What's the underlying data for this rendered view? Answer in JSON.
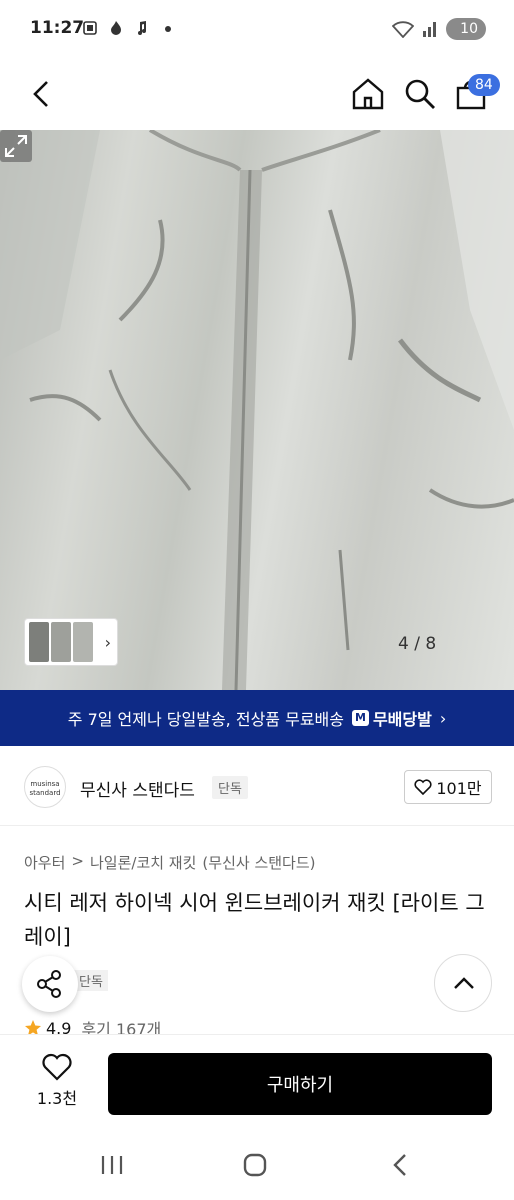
{
  "status": {
    "time": "11:27",
    "battery": "10"
  },
  "nav": {
    "cart_count": "84"
  },
  "gallery": {
    "counter": "4 / 8"
  },
  "banner": {
    "text": "주 7일 언제나 당일발송, 전상품 무료배송",
    "brand_mark": "M",
    "brand_label": "무배당발",
    "arrow": "›"
  },
  "brand": {
    "logo_line1": "musinsa",
    "logo_line2": "standard",
    "name": "무신사 스탠다드",
    "tag": "단독",
    "likes": "101만"
  },
  "product": {
    "breadcrumb": [
      "아우터",
      "나일론/코치 재킷",
      "(무신사 스탠다드)"
    ],
    "separator": ">",
    "title": "시티 레저 하이넥 시어 윈드브레이커 재킷 [라이트 그레이]",
    "tag": "단독",
    "rating": "4.9",
    "reviews": "후기 167개"
  },
  "bottom": {
    "wish_count": "1.3천",
    "buy_label": "구매하기"
  },
  "colors": {
    "banner": "#0e2a86",
    "badge": "#3b6fe0",
    "buy": "#000000",
    "star": "#f5a623"
  }
}
